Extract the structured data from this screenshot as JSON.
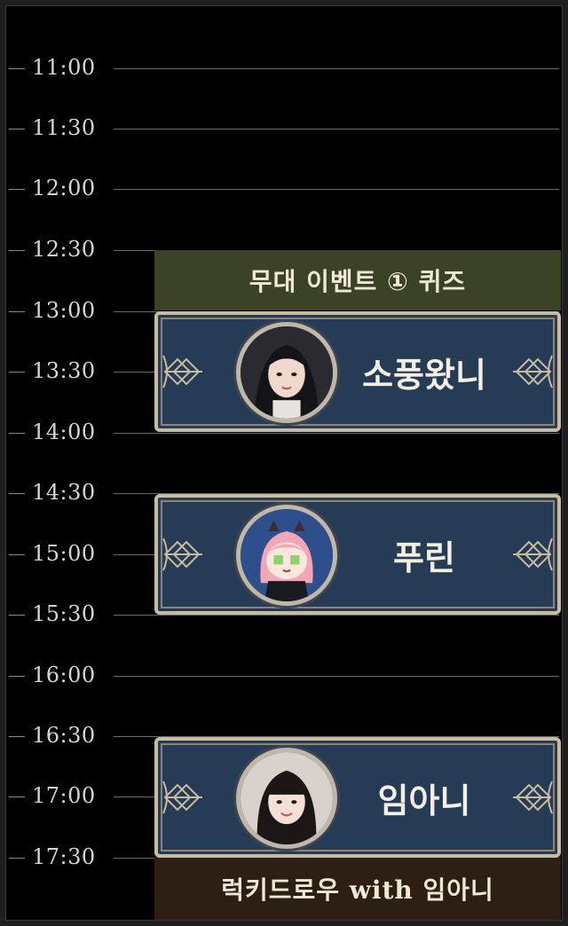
{
  "timeline": {
    "slots": [
      "11:00",
      "11:30",
      "12:00",
      "12:30",
      "13:00",
      "13:30",
      "14:00",
      "14:30",
      "15:00",
      "15:30",
      "16:00",
      "16:30",
      "17:00",
      "17:30"
    ]
  },
  "events": {
    "quiz_banner": "무대 이벤트 ① 퀴즈",
    "cards": [
      {
        "name": "소풍왔니",
        "avatar_icon": "portrait-woman-dark-hair-icon"
      },
      {
        "name": "푸린",
        "avatar_icon": "anime-character-pink-hair-icon"
      },
      {
        "name": "임아니",
        "avatar_icon": "portrait-woman-bangs-icon"
      }
    ],
    "lucky_banner": "럭키드로우 with 임아니"
  },
  "colors": {
    "background": "#000000",
    "card_fill": "#263b56",
    "card_border": "#c9bba0",
    "quiz_banner": "#3c4225",
    "lucky_banner": "#2e1f14",
    "text": "#efe9d8"
  }
}
